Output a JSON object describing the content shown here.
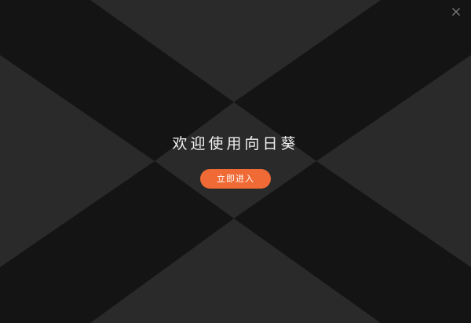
{
  "window": {
    "close_icon": "close-icon"
  },
  "welcome": {
    "title": "欢迎使用向日葵",
    "enter_button_label": "立即进入"
  },
  "colors": {
    "background": "#141414",
    "x_band": "#2a2a2a",
    "accent": "#f06a35",
    "title_text": "#f2f2f2",
    "close_icon": "#7a7a7a"
  }
}
